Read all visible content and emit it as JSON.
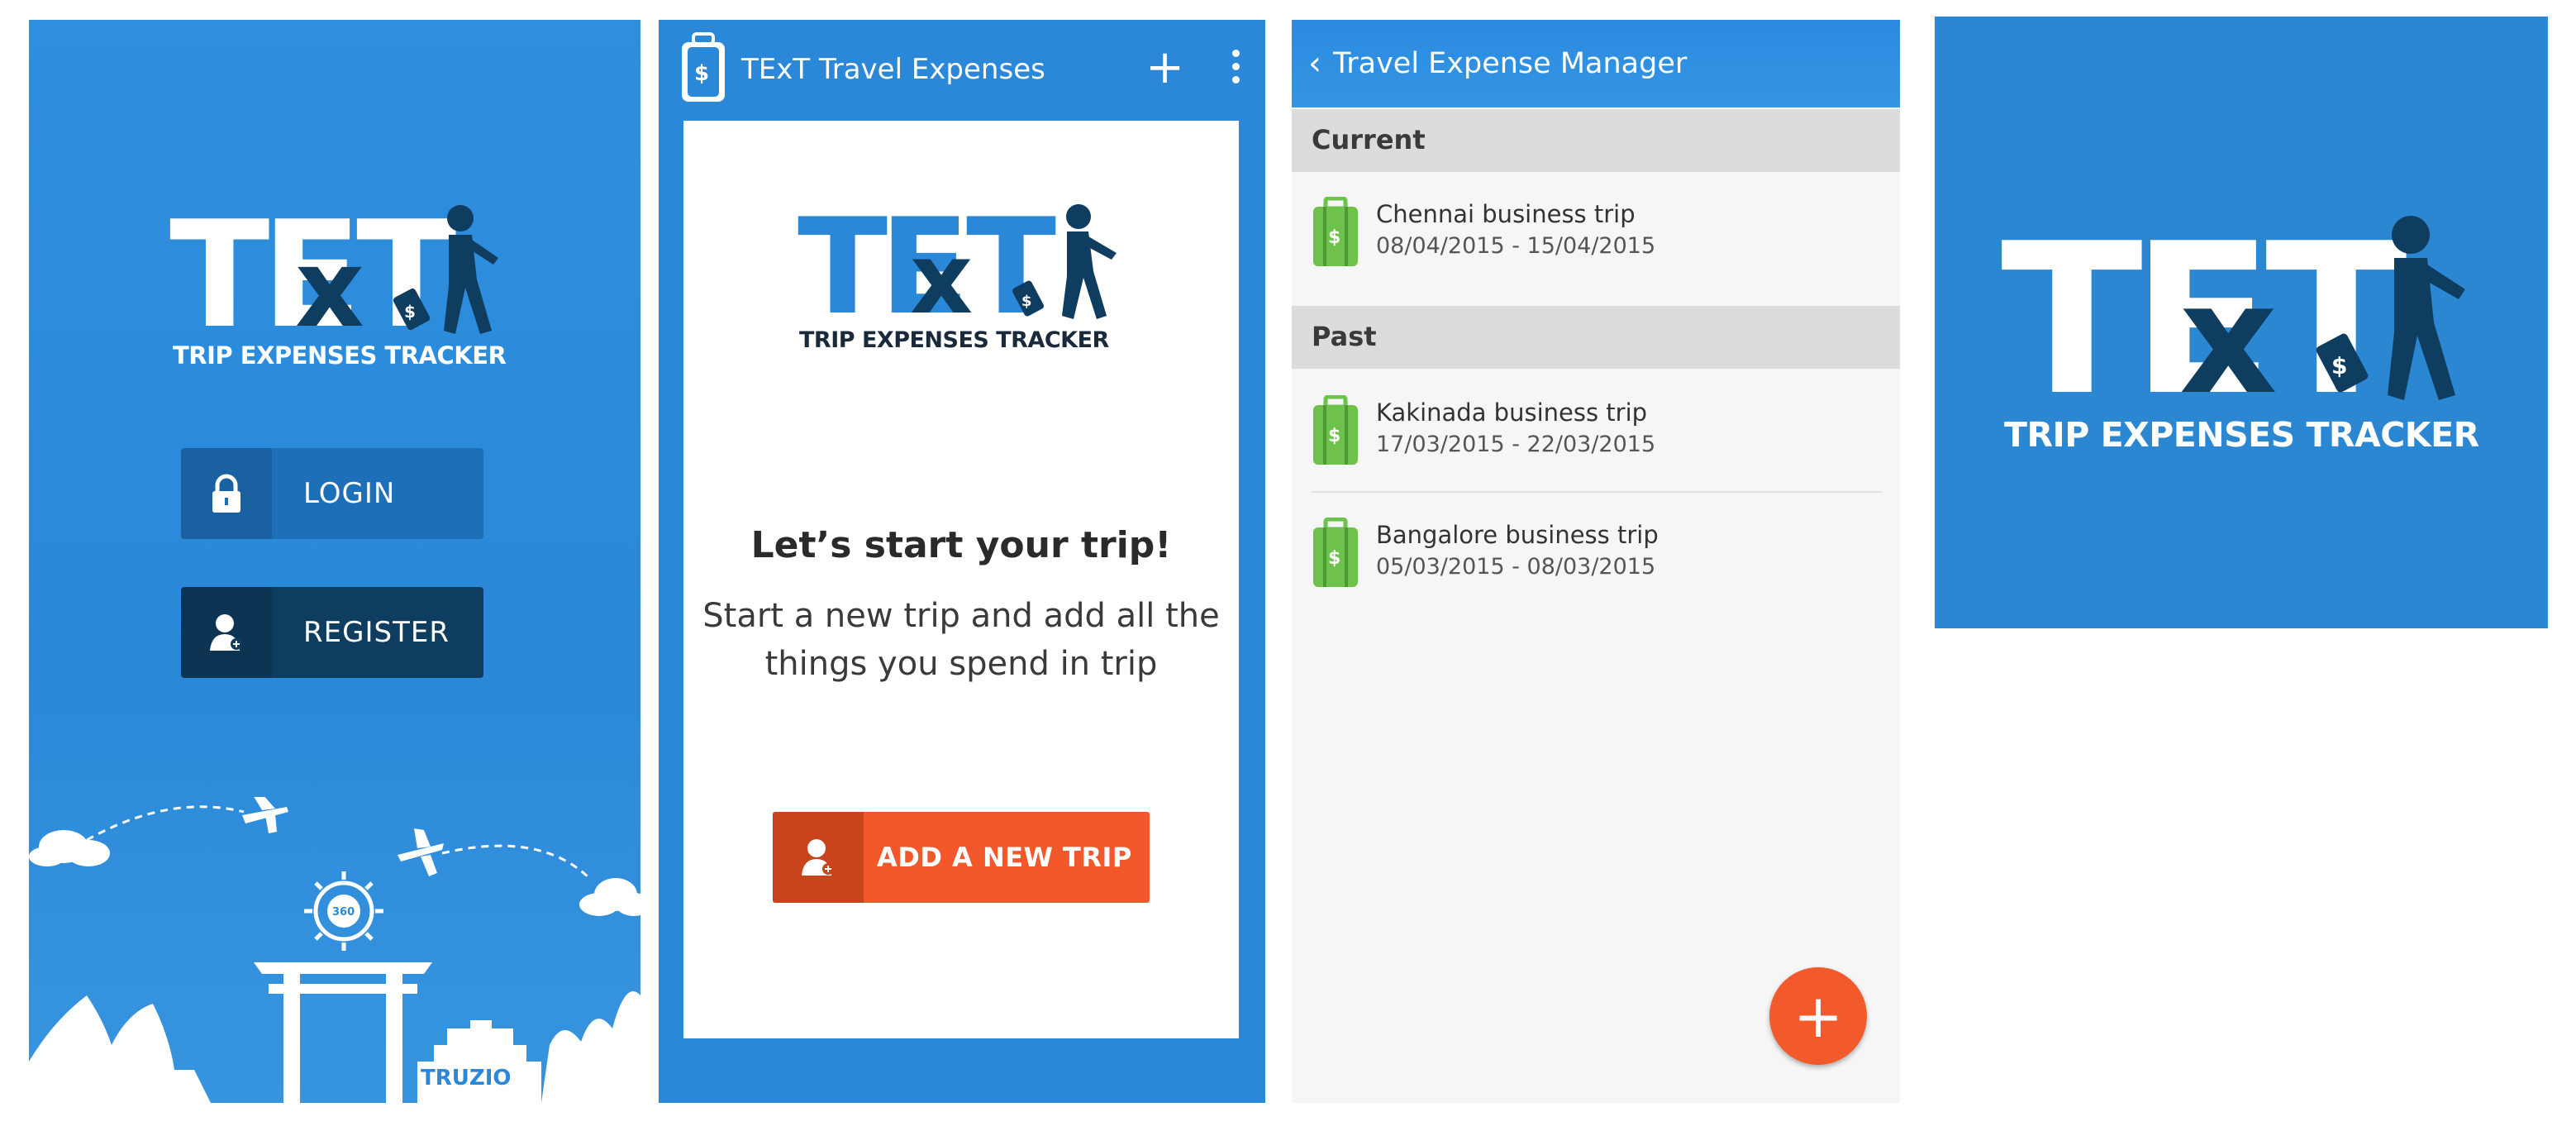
{
  "brand": {
    "logo_text": "TExT",
    "tagline": "TRIP EXPENSES TRACKER",
    "colors": {
      "primary_blue": "#2b88d9",
      "dark_navy": "#0f3d5f",
      "accent_orange": "#f2582a",
      "case_green": "#6cc24a"
    }
  },
  "login_screen": {
    "login_label": "LOGIN",
    "register_label": "REGISTER",
    "login_icon": "lock-icon",
    "register_icon": "user-icon",
    "badge_text": "360",
    "company_logo": "TRUZIO"
  },
  "start_screen": {
    "app_title": "TExT Travel Expenses",
    "add_icon": "plus-icon",
    "menu_icon": "more-vert-icon",
    "heading": "Let’s start your trip!",
    "body": "Start a new trip and add all the things you spend in trip",
    "add_trip_label": "ADD A NEW TRIP"
  },
  "trips_screen": {
    "title": "Travel Expense Manager",
    "back_icon": "chevron-left-icon",
    "current_header": "Current",
    "past_header": "Past",
    "current_trips": [
      {
        "name": "Chennai business trip",
        "dates": "08/04/2015 - 15/04/2015"
      }
    ],
    "past_trips": [
      {
        "name": "Kakinada business trip",
        "dates": "17/03/2015 - 22/03/2015"
      },
      {
        "name": "Bangalore business trip",
        "dates": "05/03/2015 - 08/03/2015"
      }
    ],
    "fab_label": "+"
  }
}
